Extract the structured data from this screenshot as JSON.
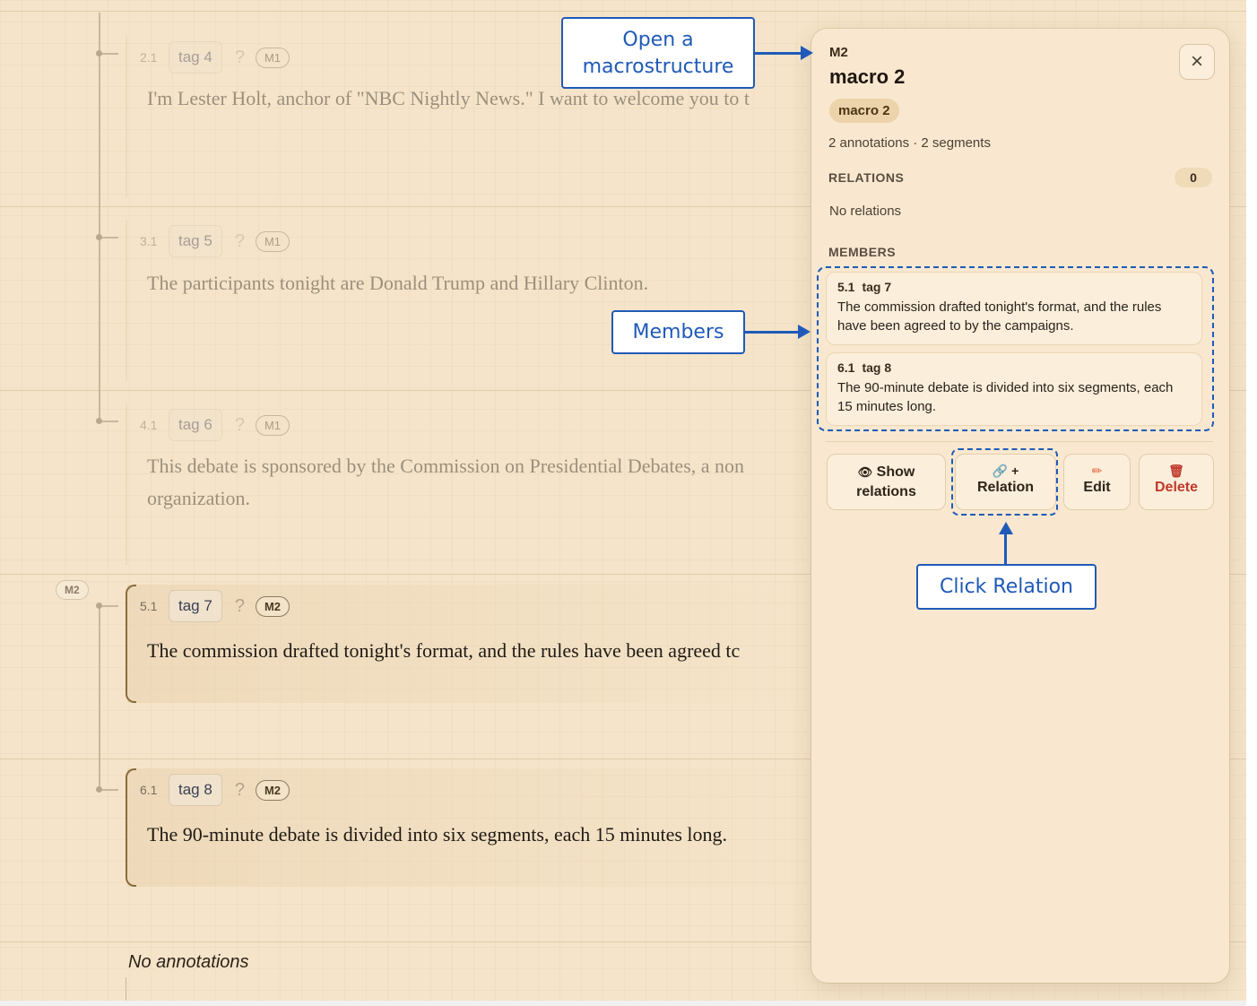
{
  "segments": [
    {
      "num": "2.1",
      "tag": "tag 4",
      "qmark": "?",
      "macro": "M1",
      "text": "I'm Lester Holt, anchor of \"NBC Nightly News.\" I want to welcome you to t"
    },
    {
      "num": "3.1",
      "tag": "tag 5",
      "qmark": "?",
      "macro": "M1",
      "text": "The participants tonight are Donald Trump and Hillary Clinton."
    },
    {
      "num": "4.1",
      "tag": "tag 6",
      "qmark": "?",
      "macro": "M1",
      "text": "This debate is sponsored by the Commission on Presidential Debates, a non",
      "text2": "organization."
    },
    {
      "num": "5.1",
      "tag": "tag 7",
      "qmark": "?",
      "macro": "M2",
      "text": "The commission drafted tonight's format, and the rules have been agreed tc"
    },
    {
      "num": "6.1",
      "tag": "tag 8",
      "qmark": "?",
      "macro": "M2",
      "text": "The 90-minute debate is divided into six segments, each 15 minutes long."
    }
  ],
  "group_label": "M2",
  "footer_text": "No annotations",
  "panel": {
    "code": "M2",
    "title": "macro 2",
    "close_icon": "×",
    "badge": "macro 2",
    "meta": "2 annotations · 2 segments",
    "relations_label": "RELATIONS",
    "relations_count": "0",
    "no_relations": "No relations",
    "members_label": "MEMBERS",
    "members": [
      {
        "num": "5.1",
        "tag": "tag 7",
        "text": "The commission drafted tonight's format, and the rules have been agreed to by the campaigns."
      },
      {
        "num": "6.1",
        "tag": "tag 8",
        "text": "The 90-minute debate is divided into six segments, each 15 minutes long."
      }
    ],
    "actions": {
      "show_icon": "👁",
      "show_label_1": "Show",
      "show_label_2": "relations",
      "relation_icon": "🔗 +",
      "relation_label": "Relation",
      "edit_icon": "✏",
      "edit_label": "Edit",
      "delete_icon": "🗑",
      "delete_label": "Delete"
    }
  },
  "callouts": {
    "open_macro_1": "Open a",
    "open_macro_2": "macrostructure",
    "members": "Members",
    "click_relation": "Click Relation"
  },
  "colors": {
    "background": "#f5e4c9",
    "panel": "#f9e8cf",
    "annotation_blue": "#1f5ab8",
    "delete_red": "#c0392b",
    "edit_orange": "#e8623a"
  }
}
